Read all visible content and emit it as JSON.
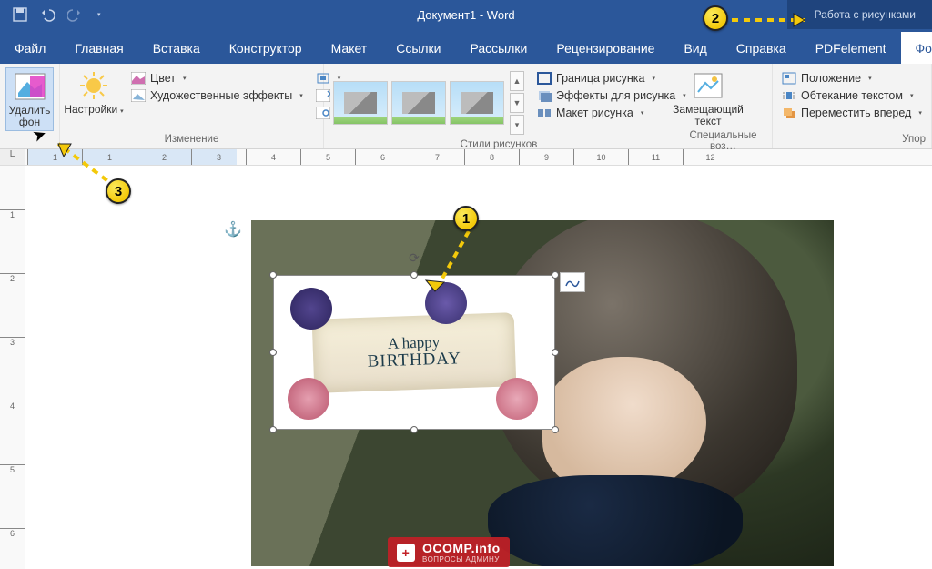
{
  "titlebar": {
    "doc_title": "Документ1 - Word",
    "context_title": "Работа с рисунками"
  },
  "tabs": [
    "Файл",
    "Главная",
    "Вставка",
    "Конструктор",
    "Макет",
    "Ссылки",
    "Рассылки",
    "Рецензирование",
    "Вид",
    "Справка",
    "PDFelement"
  ],
  "active_tab": "Формат",
  "ribbon": {
    "remove_bg": "Удалить фон",
    "corrections": "Настройки",
    "color": "Цвет",
    "artistic": "Художественные эффекты",
    "group_adjust": "Изменение",
    "group_styles": "Стили рисунков",
    "border": "Граница рисунка",
    "effects": "Эффекты для рисунка",
    "layout": "Макет рисунка",
    "alt_text": "Замещающий текст",
    "group_access": "Специальные воз…",
    "position": "Положение",
    "wrap": "Обтекание текстом",
    "forward": "Переместить вперед",
    "group_arrange": "Упор"
  },
  "card": {
    "line1": "A happy",
    "line2": "BIRTHDAY"
  },
  "callouts": {
    "c1": "1",
    "c2": "2",
    "c3": "3"
  },
  "watermark": {
    "main": "OCOMP.info",
    "sub": "ВОПРОСЫ АДМИНУ"
  },
  "ruler_marks": [
    "1",
    "1",
    "2",
    "3",
    "4",
    "5",
    "6",
    "7",
    "8",
    "9",
    "10",
    "11",
    "12"
  ],
  "ruler_v": [
    "1",
    "2",
    "3",
    "4",
    "5",
    "6"
  ],
  "ruler_corner": "L"
}
